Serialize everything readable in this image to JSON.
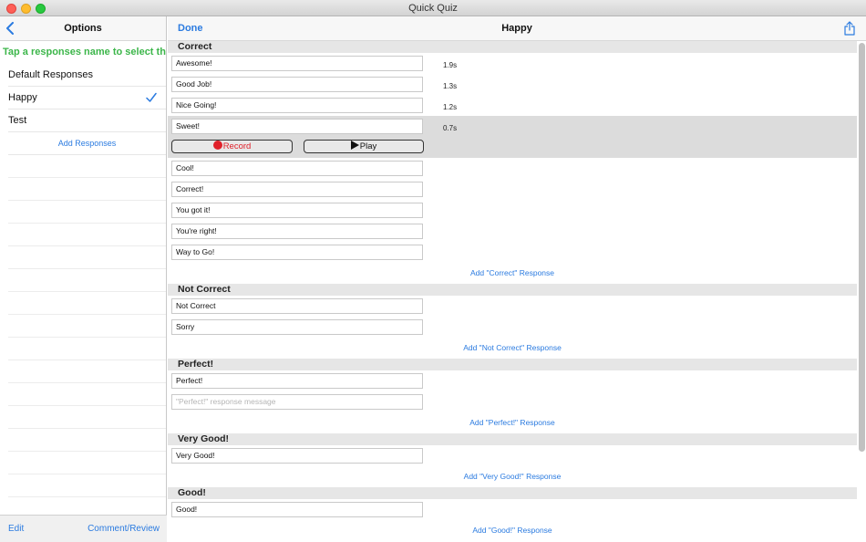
{
  "window": {
    "title": "Quick Quiz"
  },
  "sidebar": {
    "title": "Options",
    "hint": "Tap a responses name to select the",
    "items": [
      {
        "label": "Default Responses",
        "selected": false
      },
      {
        "label": "Happy",
        "selected": true
      },
      {
        "label": "Test",
        "selected": false
      }
    ],
    "add_label": "Add Responses",
    "footer": {
      "edit_label": "Edit",
      "comment_label": "Comment/Review"
    }
  },
  "main": {
    "done_label": "Done",
    "title": "Happy",
    "sections": [
      {
        "title": "Correct",
        "responses": [
          {
            "text": "Awesome!",
            "duration": "1.9s"
          },
          {
            "text": "Good Job!",
            "duration": "1.3s"
          },
          {
            "text": "Nice Going!",
            "duration": "1.2s"
          },
          {
            "text": "Sweet!",
            "duration": "0.7s",
            "selected": true
          },
          {
            "text": "Cool!"
          },
          {
            "text": "Correct!"
          },
          {
            "text": "You got it!"
          },
          {
            "text": "You're right!"
          },
          {
            "text": "Way to Go!"
          }
        ],
        "add_label": "Add \"Correct\" Response"
      },
      {
        "title": "Not Correct",
        "responses": [
          {
            "text": "Not Correct"
          },
          {
            "text": "Sorry"
          }
        ],
        "add_label": "Add \"Not Correct\" Response"
      },
      {
        "title": "Perfect!",
        "responses": [
          {
            "text": "Perfect!"
          },
          {
            "text": "",
            "placeholder": "\"Perfect!\" response message"
          }
        ],
        "add_label": "Add \"Perfect!\" Response"
      },
      {
        "title": "Very Good!",
        "responses": [
          {
            "text": "Very Good!"
          }
        ],
        "add_label": "Add \"Very Good!\" Response"
      },
      {
        "title": "Good!",
        "responses": [
          {
            "text": "Good!"
          }
        ],
        "add_label": "Add \"Good!\" Response"
      }
    ],
    "record_label": "Record",
    "play_label": "Play"
  },
  "colors": {
    "accent": "#2b7be0",
    "hint_green": "#3cb64a",
    "record_red": "#e0202a"
  }
}
